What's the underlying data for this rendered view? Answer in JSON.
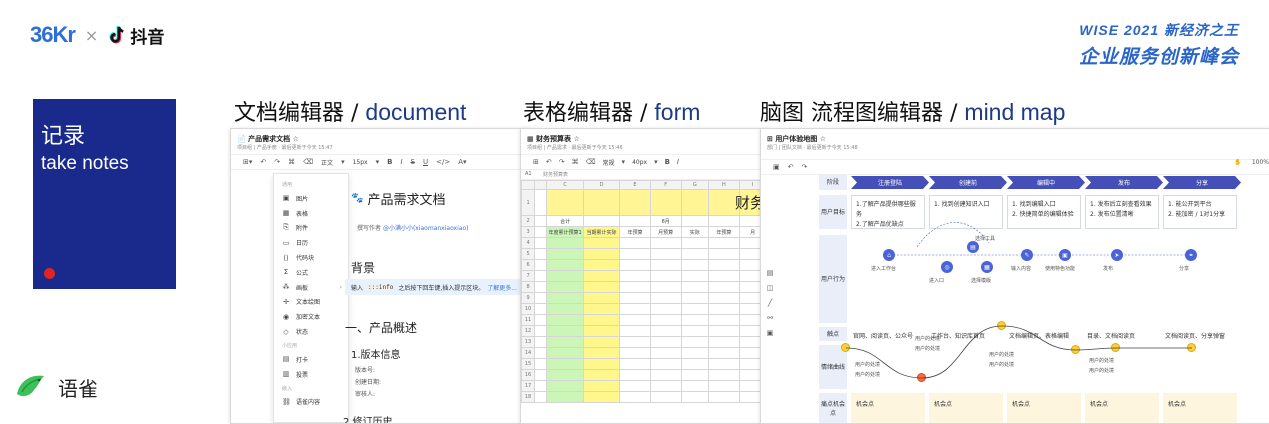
{
  "header": {
    "logo_36kr": "36Kr",
    "separator": "×",
    "douyin_label": "抖音",
    "wise_line1": "WISE 2021 新经济之王",
    "wise_line2": "企业服务创新峰会"
  },
  "card": {
    "title": "记录",
    "subtitle": "take notes",
    "accent_color": "#e02323",
    "bg_color": "#1a2a8c"
  },
  "footer_brand": {
    "label": "语雀",
    "icon": "yuque-bird-icon"
  },
  "sections": [
    {
      "cn": "文档编辑器 /",
      "en": "document"
    },
    {
      "cn": "表格编辑器 /",
      "en": "form"
    },
    {
      "cn": "脑图 流程图编辑器 /",
      "en": "mind map"
    }
  ],
  "doc": {
    "title": "产品需求文档",
    "meta": "项目组  |  产品手册  ·  最后更新于今天 15:47",
    "toolbar": {
      "style": "正文",
      "size": "15px"
    },
    "menu": {
      "group1": "通用",
      "items1": [
        "图片",
        "表格",
        "附件",
        "日历",
        "代码块",
        "公式",
        "画板",
        "文本绘图",
        "加密文本",
        "状态"
      ],
      "group2": "小应用",
      "items2": [
        "打卡",
        "投票"
      ],
      "group3": "嵌入",
      "items3": [
        "语雀内容"
      ]
    },
    "heading": "产品需求文档",
    "author_prefix": "撰写作者",
    "author_name": "@小满小小(xiaomanxiaoxiao)",
    "background_heading": "背景",
    "tip_prefix": "输入",
    "tip_code": ":::info",
    "tip_text": "之后按下回车键,插入提示区块。",
    "tip_link": "了解更多...",
    "overview_heading": "一、产品概述",
    "version_heading": "1.版本信息",
    "fields": [
      "版本号:",
      "创建日期:",
      "审核人:"
    ],
    "history_heading": "2.修订历史"
  },
  "form": {
    "title": "财务预算表",
    "meta": "项目组  |  产品需求  ·  最后更新于今天 15:46",
    "toolbar": {
      "style": "常规",
      "size": "40px"
    },
    "cellref": "A1",
    "formula": "财务预算表",
    "columns": [
      "C",
      "D",
      "E",
      "F",
      "G",
      "H",
      "I",
      "J"
    ],
    "rows": [
      "1",
      "2",
      "3",
      "4",
      "5",
      "6",
      "7",
      "8",
      "9",
      "10",
      "11",
      "12",
      "13",
      "14",
      "15",
      "16",
      "17",
      "18"
    ],
    "banner": "财务",
    "row2": {
      "total": "合计",
      "month": "8月"
    },
    "row3": [
      "年度累计预算1",
      "当期累计实际",
      "年预算",
      "月预算",
      "实际",
      "年预算",
      "月"
    ]
  },
  "mind": {
    "title": "用户体验地图",
    "meta": "部门  |  团队文档  ·  最后更新于今天 15:48",
    "zoom": "100%",
    "row_labels": [
      "阶段",
      "用户目标",
      "用户行为",
      "触点",
      "情绪曲线",
      "痛点机会点"
    ],
    "stages": [
      "注册登陆",
      "创建前",
      "编辑中",
      "发布",
      "分享"
    ],
    "goals": [
      [
        "1.了解产品提供哪些服务",
        "2.了解产品优缺点"
      ],
      [
        "1. 找到创建知识入口"
      ],
      [
        "1. 找到编辑入口",
        "2. 快捷简单的编辑体验"
      ],
      [
        "1. 发布后立刻查看效果",
        "2. 发布位置清晰"
      ],
      [
        "1. 能公开到平台",
        "2. 能加密 / 1对1分享"
      ]
    ],
    "actions": [
      "进入工作台",
      "进入口",
      "选择工具",
      "选择模版",
      "输入内容",
      "使用特色功能",
      "发布",
      "分享"
    ],
    "touchpoints": [
      "官网、阅读页、公众号",
      "工作台、知识库首页",
      "文档编辑页、表格编辑",
      "目录、文档阅读页",
      "文档阅读页、分享弹窗"
    ],
    "emotion_labels": [
      "用户的处境",
      "用户的处境",
      "用户的处境",
      "用户的处境",
      "用户的处境",
      "用户的处境",
      "用户的处境",
      "用户的处境"
    ],
    "opportunity": [
      "机会点",
      "机会点",
      "机会点",
      "机会点",
      "机会点"
    ]
  }
}
